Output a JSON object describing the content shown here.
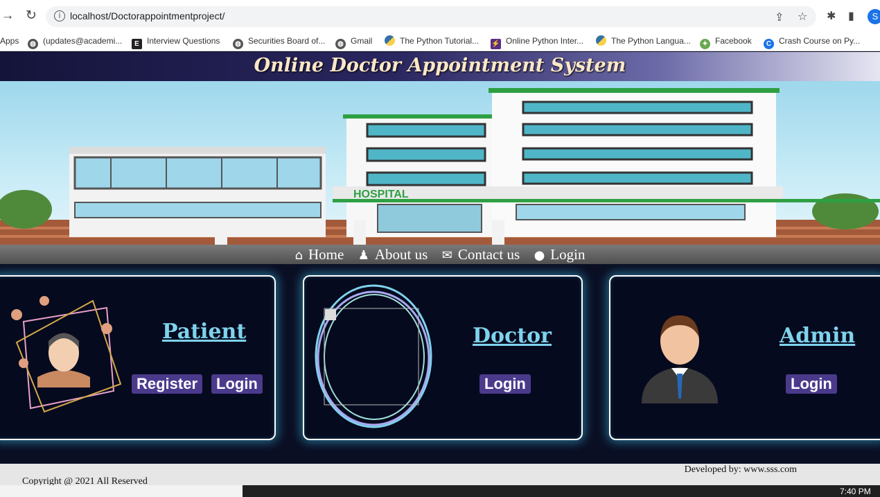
{
  "browser": {
    "url": "localhost/Doctorappointmentproject/",
    "profile_initial": "S",
    "bookmarks": [
      {
        "label": "Apps",
        "icon": "apps-icon"
      },
      {
        "label": "(updates@academi...",
        "icon": "globe-icon"
      },
      {
        "label": "Interview Questions",
        "icon": "e-logo-icon"
      },
      {
        "label": "Securities Board of...",
        "icon": "globe-icon"
      },
      {
        "label": "Gmail",
        "icon": "globe-icon"
      },
      {
        "label": "The Python Tutorial...",
        "icon": "python-icon"
      },
      {
        "label": "Online Python Inter...",
        "icon": "bolt-icon"
      },
      {
        "label": "The Python Langua...",
        "icon": "python-icon"
      },
      {
        "label": "Facebook",
        "icon": "leaf-icon"
      },
      {
        "label": "Crash Course on Py...",
        "icon": "coursera-icon"
      }
    ]
  },
  "site": {
    "title": "Online Doctor Appointment System",
    "banner_sign": "HOSPITAL",
    "nav": [
      {
        "label": "Home",
        "icon": "home-icon"
      },
      {
        "label": "About us",
        "icon": "doctor-icon"
      },
      {
        "label": "Contact us",
        "icon": "envelope-icon"
      },
      {
        "label": "Login",
        "icon": "user-icon"
      }
    ],
    "cards": {
      "patient": {
        "title": "Patient",
        "register": "Register",
        "login": "Login"
      },
      "doctor": {
        "title": "Doctor",
        "login": "Login"
      },
      "admin": {
        "title": "Admin",
        "login": "Login"
      }
    },
    "footer": {
      "developed": "Developed by: www.sss.com",
      "copyright": "Copyright @ 2021 All Reserved"
    }
  },
  "taskbar": {
    "time": "7:40 PM"
  },
  "colors": {
    "accent": "#7ed3ec",
    "button": "#4b3a8c",
    "page_bg": "#0a0f24",
    "glow": "#3cb4dc"
  }
}
